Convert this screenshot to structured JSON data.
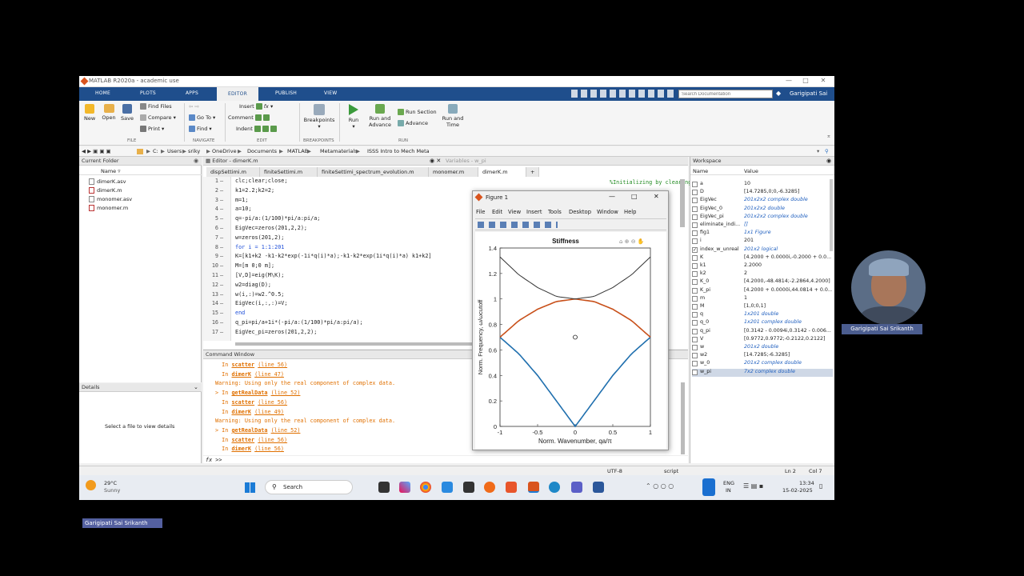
{
  "window": {
    "title": "MATLAB R2020a - academic use"
  },
  "tabs": [
    "HOME",
    "PLOTS",
    "APPS",
    "EDITOR",
    "PUBLISH",
    "VIEW"
  ],
  "search": {
    "placeholder": "Search Documentation"
  },
  "user": "Garigipati Sai",
  "ribbon": {
    "new": "New",
    "open": "Open",
    "save": "Save",
    "find_files": "Find Files",
    "compare": "Compare",
    "print": "Print",
    "file_group": "FILE",
    "go_to": "Go To",
    "find": "Find",
    "navigate_group": "NAVIGATE",
    "insert": "Insert",
    "comment": "Comment",
    "indent": "Indent",
    "edit_group": "EDIT",
    "breakpoints": "Breakpoints",
    "breakpoints_group": "BREAKPOINTS",
    "run": "Run",
    "run_and_advance": "Run and Advance",
    "run_section": "Run Section",
    "advance": "Advance",
    "run_and_time": "Run and Time",
    "run_group": "RUN"
  },
  "path": [
    "C:",
    "Users",
    "sriky",
    "OneDrive",
    "Documents",
    "MATLAB",
    "Metamaterials",
    "ISSS Intro to Mech Meta"
  ],
  "current_folder": {
    "title": "Current Folder",
    "column": "Name",
    "files": [
      "dimerK.asv",
      "dimerK.m",
      "monomer.asv",
      "monomer.m"
    ]
  },
  "details": {
    "title": "Details",
    "empty": "Select a file to view details"
  },
  "editor": {
    "title": "Editor - dimerK.m",
    "variables_title": "Variables - w_pi",
    "tabs": [
      "dispSettimi.m",
      "finiteSettimi.m",
      "finiteSettimi_spectrum_evolution.m",
      "monomer.m",
      "dimerK.m"
    ],
    "lines": [
      "clc;clear;close;",
      "k1=2.2;k2=2;",
      "m=1;",
      "a=10;",
      "q=-pi/a:(1/100)*pi/a:pi/a;",
      "EigVec=zeros(201,2,2);",
      "w=zeros(201,2);",
      "for i = 1:1:201",
      "K=[k1+k2 -k1-k2*exp(-1i*q(i)*a);-k1-k2*exp(1i*q(i)*a) k1+k2]",
      "M=[m 0;0 m];",
      "[V,D]=eig(M\\K);",
      "w2=diag(D);",
      "w(i,:)=w2.^0.5;",
      "EigVec(i,:,:)=V;",
      "end",
      "q_pi=pi/a+1i*(-pi/a:(1/100)*pi/a:pi/a);",
      "EigVec_pi=zeros(201,2,2);"
    ],
    "comment": "%Initializing by clearing previous s"
  },
  "command": {
    "title": "Command Window",
    "prompt": ">>",
    "lines": [
      {
        "pre": "  In ",
        "fn": "scatter",
        "loc": "(line 56)"
      },
      {
        "pre": "  In ",
        "fn": "dimerK",
        "loc": "(line 47)"
      },
      {
        "warn": "Warning: Using only the real component of complex data."
      },
      {
        "pre": "> In ",
        "fn": "getRealData",
        "loc": "(line 52)"
      },
      {
        "pre": "  In ",
        "fn": "scatter",
        "loc": "(line 56)"
      },
      {
        "pre": "  In ",
        "fn": "dimerK",
        "loc": "(line 49)"
      },
      {
        "warn": "Warning: Using only the real component of complex data."
      },
      {
        "pre": "> In ",
        "fn": "getRealData",
        "loc": "(line 52)"
      },
      {
        "pre": "  In ",
        "fn": "scatter",
        "loc": "(line 56)"
      },
      {
        "pre": "  In ",
        "fn": "dimerK",
        "loc": "(line 56)"
      }
    ]
  },
  "workspace": {
    "title": "Workspace",
    "col_name": "Name",
    "col_value": "Value",
    "vars": [
      {
        "n": "a",
        "v": "10",
        "i": false
      },
      {
        "n": "D",
        "v": "[14.7285,0;0,-6.3285]",
        "i": false
      },
      {
        "n": "EigVec",
        "v": "201x2x2 complex double",
        "i": true
      },
      {
        "n": "EigVec_0",
        "v": "201x2x2 double",
        "i": true
      },
      {
        "n": "EigVec_pi",
        "v": "201x2x2 complex double",
        "i": true
      },
      {
        "n": "eliminate_indi...",
        "v": "[]",
        "i": true
      },
      {
        "n": "fig1",
        "v": "1x1 Figure",
        "i": true
      },
      {
        "n": "i",
        "v": "201",
        "i": false
      },
      {
        "n": "index_w_unreal",
        "v": "201x2 logical",
        "i": true
      },
      {
        "n": "K",
        "v": "[4.2000 + 0.0000i,-0.2000 + 0.0...",
        "i": false
      },
      {
        "n": "k1",
        "v": "2.2000",
        "i": false
      },
      {
        "n": "k2",
        "v": "2",
        "i": false
      },
      {
        "n": "K_0",
        "v": "[4.2000,-48.4814;-2.2864,4.2000]",
        "i": false
      },
      {
        "n": "K_pi",
        "v": "[4.2000 + 0.0000i,44.0814 + 0.0...",
        "i": false
      },
      {
        "n": "m",
        "v": "1",
        "i": false
      },
      {
        "n": "M",
        "v": "[1,0;0,1]",
        "i": false
      },
      {
        "n": "q",
        "v": "1x201 double",
        "i": true
      },
      {
        "n": "q_0",
        "v": "1x201 complex double",
        "i": true
      },
      {
        "n": "q_pi",
        "v": "[0.3142 - 0.0094i,0.3142 - 0.006...",
        "i": false
      },
      {
        "n": "V",
        "v": "[0.9772,0.9772;-0.2122,0.2122]",
        "i": false
      },
      {
        "n": "w",
        "v": "201x2 double",
        "i": true
      },
      {
        "n": "w2",
        "v": "[14.7285;-6.3285]",
        "i": false
      },
      {
        "n": "w_0",
        "v": "201x2 complex double",
        "i": true
      },
      {
        "n": "w_pi",
        "v": "7x2 complex double",
        "i": true
      }
    ]
  },
  "status": {
    "encoding": "UTF-8",
    "type": "script",
    "ln": "Ln  2",
    "col": "Col  7"
  },
  "figure": {
    "title": "Figure 1",
    "menu": [
      "File",
      "Edit",
      "View",
      "Insert",
      "Tools",
      "Desktop",
      "Window",
      "Help"
    ]
  },
  "chart_data": {
    "type": "line",
    "title": "Stiffness",
    "xlabel": "Norm. Wavenumber, qa/π",
    "ylabel": "Norm. Frequency, ω/ωcutoff",
    "xlim": [
      -1,
      1
    ],
    "ylim": [
      0,
      1.4
    ],
    "xticks": [
      "-1",
      "-0.5",
      "0",
      "0.5",
      "1"
    ],
    "yticks": [
      "0",
      "0.2",
      "0.4",
      "0.6",
      "0.8",
      "1",
      "1.2",
      "1.4"
    ],
    "series": [
      {
        "color": "#1f6fae",
        "x": [
          -1,
          -0.75,
          -0.5,
          -0.25,
          0,
          0.25,
          0.5,
          0.75,
          1
        ],
        "y": [
          0.7,
          0.57,
          0.4,
          0.2,
          0,
          0.2,
          0.4,
          0.57,
          0.7
        ]
      },
      {
        "color": "#c8501a",
        "x": [
          -1,
          -0.75,
          -0.5,
          -0.25,
          0,
          0.25,
          0.5,
          0.75,
          1
        ],
        "y": [
          0.7,
          0.83,
          0.92,
          0.98,
          1,
          0.98,
          0.92,
          0.83,
          0.7
        ]
      },
      {
        "color": "#333333",
        "x": [
          -1,
          -0.75,
          -0.5,
          -0.25,
          0,
          0.25,
          0.5,
          0.75,
          1
        ],
        "y": [
          1.33,
          1.19,
          1.09,
          1.02,
          1,
          1.02,
          1.09,
          1.19,
          1.33
        ]
      }
    ]
  },
  "taskbar": {
    "temp": "29°C",
    "weather": "Sunny",
    "search": "Search",
    "lang1": "ENG",
    "lang2": "IN",
    "time": "13:34",
    "date": "15-02-2025"
  },
  "presenter": {
    "name": "Garigipati Sai Srikanth",
    "name2": "Garigipati Sai Srikanth"
  }
}
